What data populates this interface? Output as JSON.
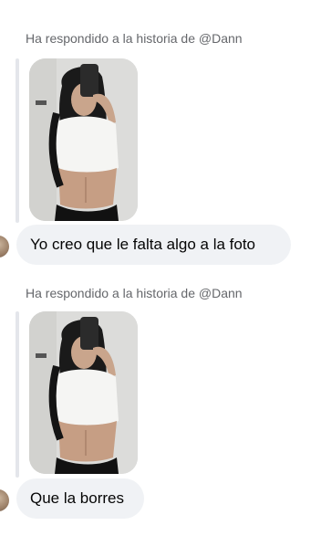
{
  "messages": [
    {
      "reply_label": "Ha respondido a la historia de @Dann",
      "story_icon": "story-photo-thumbnail",
      "text": "Yo creo que le falta algo a la foto"
    },
    {
      "reply_label": "Ha respondido a la historia de @Dann",
      "story_icon": "story-photo-thumbnail",
      "text": "Que la borres"
    }
  ],
  "colors": {
    "label_text": "#65676b",
    "bubble_bg": "#f0f2f5",
    "bubble_text": "#050505",
    "quote_bar": "#e4e6eb"
  }
}
